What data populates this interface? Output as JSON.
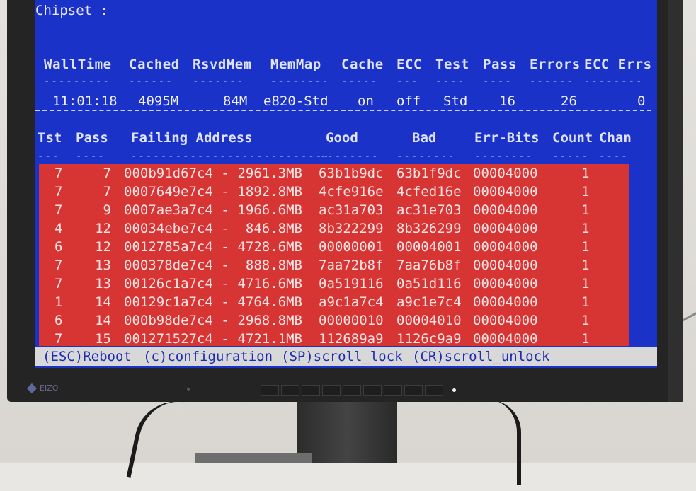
{
  "chipset_label": "Chipset :",
  "summary_headers": [
    "WallTime",
    "Cached",
    "RsvdMem",
    "MemMap",
    "Cache",
    "ECC",
    "Test",
    "Pass",
    "Errors",
    "ECC Errs"
  ],
  "summary_values": [
    "11:01:18",
    "4095M",
    "84M",
    "e820-Std",
    "on",
    "off",
    "Std",
    "16",
    "26",
    "0"
  ],
  "error_headers": [
    "Tst",
    "Pass",
    "Failing Address",
    "Good",
    "Bad",
    "Err-Bits",
    "Count",
    "Chan"
  ],
  "errors": [
    {
      "tst": "7",
      "pass": "7",
      "addr": "000b91d67c4 -",
      "mb": "2961.3MB",
      "good": "63b1b9dc",
      "bad": "63b1f9dc",
      "bits": "00004000",
      "count": "1"
    },
    {
      "tst": "7",
      "pass": "7",
      "addr": "0007649e7c4 -",
      "mb": "1892.8MB",
      "good": "4cfe916e",
      "bad": "4cfed16e",
      "bits": "00004000",
      "count": "1"
    },
    {
      "tst": "7",
      "pass": "9",
      "addr": "0007ae3a7c4 -",
      "mb": "1966.6MB",
      "good": "ac31a703",
      "bad": "ac31e703",
      "bits": "00004000",
      "count": "1"
    },
    {
      "tst": "4",
      "pass": "12",
      "addr": "00034ebe7c4 -",
      "mb": "846.8MB",
      "good": "8b322299",
      "bad": "8b326299",
      "bits": "00004000",
      "count": "1"
    },
    {
      "tst": "6",
      "pass": "12",
      "addr": "0012785a7c4 -",
      "mb": "4728.6MB",
      "good": "00000001",
      "bad": "00004001",
      "bits": "00004000",
      "count": "1"
    },
    {
      "tst": "7",
      "pass": "13",
      "addr": "000378de7c4 -",
      "mb": "888.8MB",
      "good": "7aa72b8f",
      "bad": "7aa76b8f",
      "bits": "00004000",
      "count": "1"
    },
    {
      "tst": "7",
      "pass": "13",
      "addr": "00126c1a7c4 -",
      "mb": "4716.6MB",
      "good": "0a519116",
      "bad": "0a51d116",
      "bits": "00004000",
      "count": "1"
    },
    {
      "tst": "1",
      "pass": "14",
      "addr": "00129c1a7c4 -",
      "mb": "4764.6MB",
      "good": "a9c1a7c4",
      "bad": "a9c1e7c4",
      "bits": "00004000",
      "count": "1"
    },
    {
      "tst": "6",
      "pass": "14",
      "addr": "000b98de7c4 -",
      "mb": "2968.8MB",
      "good": "00000010",
      "bad": "00004010",
      "bits": "00004000",
      "count": "1"
    },
    {
      "tst": "7",
      "pass": "15",
      "addr": "001271527c4 -",
      "mb": "4721.1MB",
      "good": "112689a9",
      "bad": "1126c9a9",
      "bits": "00004000",
      "count": "1"
    }
  ],
  "footer": {
    "reboot": "(ESC)Reboot",
    "config": "(c)configuration",
    "scroll_lock": "(SP)scroll_lock",
    "scroll_unlock": "(CR)scroll_unlock"
  },
  "brand": "EIZO",
  "colors": {
    "screen_bg": "#1a32c8",
    "error_bg": "#d73434",
    "footer_bg": "#d8d8d8"
  }
}
